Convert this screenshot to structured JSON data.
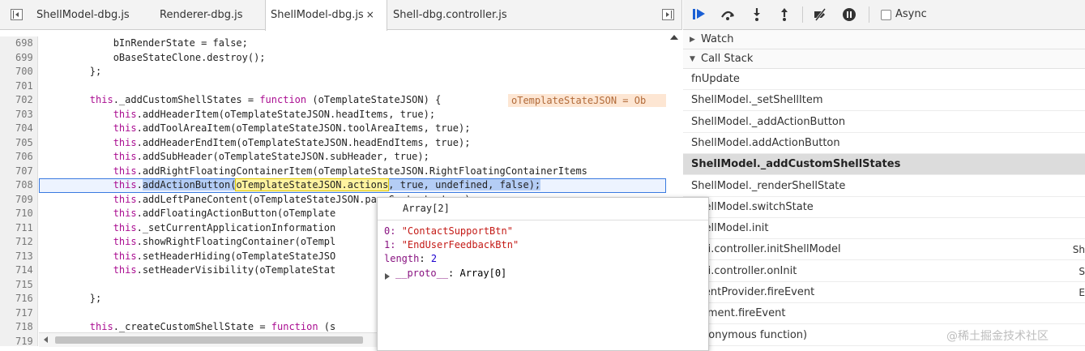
{
  "tabs": [
    {
      "label": "ShellModel-dbg.js"
    },
    {
      "label": "Renderer-dbg.js"
    },
    {
      "label": "ShellModel-dbg.js",
      "close": "×"
    },
    {
      "label": "Shell-dbg.controller.js"
    }
  ],
  "code": {
    "lines": [
      {
        "num": "698",
        "parts": [
          {
            "t": "            bInRenderState = false;",
            "c": ""
          }
        ]
      },
      {
        "num": "699",
        "parts": [
          {
            "t": "            oBaseStateClone.destroy();",
            "c": ""
          }
        ]
      },
      {
        "num": "700",
        "parts": [
          {
            "t": "        };",
            "c": ""
          }
        ]
      },
      {
        "num": "701",
        "parts": []
      },
      {
        "num": "702",
        "parts": [
          {
            "t": "        ",
            "c": ""
          },
          {
            "t": "this",
            "c": "kw"
          },
          {
            "t": "._addCustomShellStates = ",
            "c": ""
          },
          {
            "t": "function",
            "c": "kw"
          },
          {
            "t": " (oTemplateStateJSON) {",
            "c": ""
          }
        ]
      },
      {
        "num": "703",
        "parts": [
          {
            "t": "            ",
            "c": ""
          },
          {
            "t": "this",
            "c": "kw"
          },
          {
            "t": ".addHeaderItem(oTemplateStateJSON.headItems, true);",
            "c": ""
          }
        ]
      },
      {
        "num": "704",
        "parts": [
          {
            "t": "            ",
            "c": ""
          },
          {
            "t": "this",
            "c": "kw"
          },
          {
            "t": ".addToolAreaItem(oTemplateStateJSON.toolAreaItems, true);",
            "c": ""
          }
        ]
      },
      {
        "num": "705",
        "parts": [
          {
            "t": "            ",
            "c": ""
          },
          {
            "t": "this",
            "c": "kw"
          },
          {
            "t": ".addHeaderEndItem(oTemplateStateJSON.headEndItems, true);",
            "c": ""
          }
        ]
      },
      {
        "num": "706",
        "parts": [
          {
            "t": "            ",
            "c": ""
          },
          {
            "t": "this",
            "c": "kw"
          },
          {
            "t": ".addSubHeader(oTemplateStateJSON.subHeader, true);",
            "c": ""
          }
        ]
      },
      {
        "num": "707",
        "parts": [
          {
            "t": "            ",
            "c": ""
          },
          {
            "t": "this",
            "c": "kw"
          },
          {
            "t": ".addRightFloatingContainerItem(oTemplateStateJSON.RightFloatingContainerItems",
            "c": ""
          }
        ]
      },
      {
        "num": "708",
        "parts": [
          {
            "t": "            ",
            "c": ""
          },
          {
            "t": "this",
            "c": "kw"
          },
          {
            "t": ".",
            "c": ""
          },
          {
            "t": "addActionButton",
            "c": "sel"
          },
          {
            "t": "(",
            "c": "sel"
          },
          {
            "t": "oTemplateStateJSON.actions",
            "c": "ev"
          },
          {
            "t": ", true, undefined, false);",
            "c": "sel"
          }
        ]
      },
      {
        "num": "709",
        "parts": [
          {
            "t": "            ",
            "c": ""
          },
          {
            "t": "this",
            "c": "kw"
          },
          {
            "t": ".addLeftPaneContent(oTemplateStateJSON.paneContent, true);",
            "c": ""
          }
        ]
      },
      {
        "num": "710",
        "parts": [
          {
            "t": "            ",
            "c": ""
          },
          {
            "t": "this",
            "c": "kw"
          },
          {
            "t": ".addFloatingActionButton(oTemplate",
            "c": ""
          }
        ]
      },
      {
        "num": "711",
        "parts": [
          {
            "t": "            ",
            "c": ""
          },
          {
            "t": "this",
            "c": "kw"
          },
          {
            "t": "._setCurrentApplicationInformation",
            "c": ""
          }
        ]
      },
      {
        "num": "712",
        "parts": [
          {
            "t": "            ",
            "c": ""
          },
          {
            "t": "this",
            "c": "kw"
          },
          {
            "t": ".showRightFloatingContainer(oTempl",
            "c": ""
          }
        ]
      },
      {
        "num": "713",
        "parts": [
          {
            "t": "            ",
            "c": ""
          },
          {
            "t": "this",
            "c": "kw"
          },
          {
            "t": ".setHeaderHiding(oTemplateStateJSO",
            "c": ""
          }
        ]
      },
      {
        "num": "714",
        "parts": [
          {
            "t": "            ",
            "c": ""
          },
          {
            "t": "this",
            "c": "kw"
          },
          {
            "t": ".setHeaderVisibility(oTemplateStat",
            "c": ""
          }
        ]
      },
      {
        "num": "715",
        "parts": []
      },
      {
        "num": "716",
        "parts": [
          {
            "t": "        };",
            "c": ""
          }
        ]
      },
      {
        "num": "717",
        "parts": []
      },
      {
        "num": "718",
        "parts": [
          {
            "t": "        ",
            "c": ""
          },
          {
            "t": "this",
            "c": "kw"
          },
          {
            "t": "._createCustomShellState = ",
            "c": ""
          },
          {
            "t": "function",
            "c": "kw"
          },
          {
            "t": " (s",
            "c": ""
          }
        ]
      },
      {
        "num": "719",
        "parts": []
      }
    ],
    "inline_value": "oTemplateStateJSON = Ob"
  },
  "debugger": {
    "async_label": "Async",
    "watch_label": "Watch",
    "callstack_label": "Call Stack",
    "frames": [
      {
        "name": "fnUpdate",
        "loc": ""
      },
      {
        "name": "ShellModel._setShellItem",
        "loc": ""
      },
      {
        "name": "ShellModel._addActionButton",
        "loc": ""
      },
      {
        "name": "ShellModel.addActionButton",
        "loc": ""
      },
      {
        "name": "ShellModel._addCustomShellStates",
        "loc": ""
      },
      {
        "name": "ShellModel._renderShellState",
        "loc": ""
      },
      {
        "name": "ShellModel.switchState",
        "loc": ""
      },
      {
        "name": "ShellModel.init",
        "loc": ""
      },
      {
        "name": "...ui.controller.initShellModel",
        "loc": "Sh"
      },
      {
        "name": "...ui.controller.onInit",
        "loc": "S"
      },
      {
        "name": "EventProvider.fireEvent",
        "loc": "E"
      },
      {
        "name": "Element.fireEvent",
        "loc": ""
      },
      {
        "name": "(anonymous function)",
        "loc": ""
      }
    ],
    "selected_frame": 4
  },
  "popover": {
    "title": "Array[2]",
    "items": [
      {
        "key": "0",
        "value": "\"ContactSupportBtn\""
      },
      {
        "key": "1",
        "value": "\"EndUserFeedbackBtn\""
      }
    ],
    "length_key": "length",
    "length_value": "2",
    "proto_key": "__proto__",
    "proto_value": "Array[0]"
  },
  "watermark": "@稀土掘金技术社区"
}
